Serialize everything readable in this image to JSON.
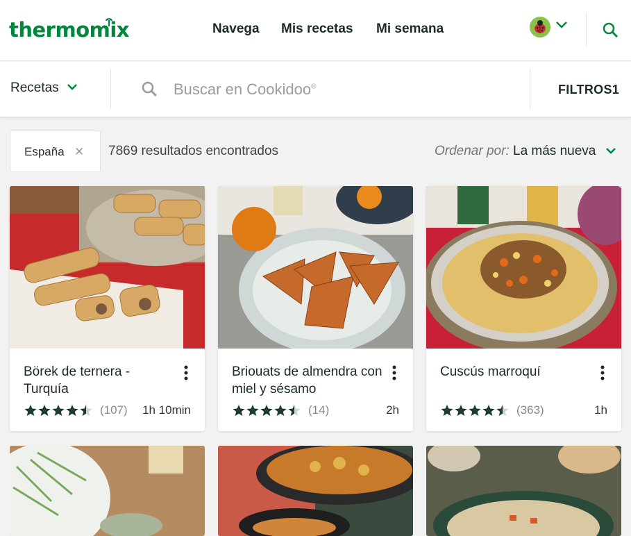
{
  "header": {
    "logo": "thermomix",
    "nav": [
      "Navega",
      "Mis recetas",
      "Mi semana"
    ],
    "flag_icon": "ladybug-flag-icon",
    "accent": "#00873c"
  },
  "searchbar": {
    "category": "Recetas",
    "placeholder": "Buscar en Cookidoo",
    "trademark": "®",
    "filters_label": "FILTROS",
    "filters_count": "1"
  },
  "results_bar": {
    "chip_label": "España",
    "chip_close": "✕",
    "results_text": "7869 resultados encontrados",
    "sort_prefix": "Ordenar por:",
    "sort_value": "La más nueva"
  },
  "cards": [
    {
      "title": "Börek de ternera - Turquía",
      "rating": 4.5,
      "reviews": "(107)",
      "time": "1h 10min"
    },
    {
      "title": "Briouats de almendra con miel y sésamo",
      "rating": 4.5,
      "reviews": "(14)",
      "time": "2h"
    },
    {
      "title": "Cuscús marroquí",
      "rating": 4.5,
      "reviews": "(363)",
      "time": "1h"
    }
  ]
}
